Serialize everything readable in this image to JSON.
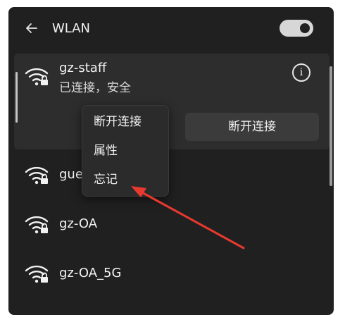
{
  "header": {
    "title": "WLAN",
    "back_icon": "arrow-left-icon",
    "wifi_toggle_on": true
  },
  "connected": {
    "ssid": "gz-staff",
    "status": "已连接，安全",
    "info_icon": "i",
    "disconnect_label": "断开连接"
  },
  "networks": [
    {
      "ssid": "gue"
    },
    {
      "ssid": "gz-OA"
    },
    {
      "ssid": "gz-OA_5G"
    }
  ],
  "context_menu": {
    "items": [
      {
        "label": "断开连接"
      },
      {
        "label": "属性"
      },
      {
        "label": "忘记"
      }
    ]
  },
  "annotation": {
    "color": "#e8392f"
  }
}
